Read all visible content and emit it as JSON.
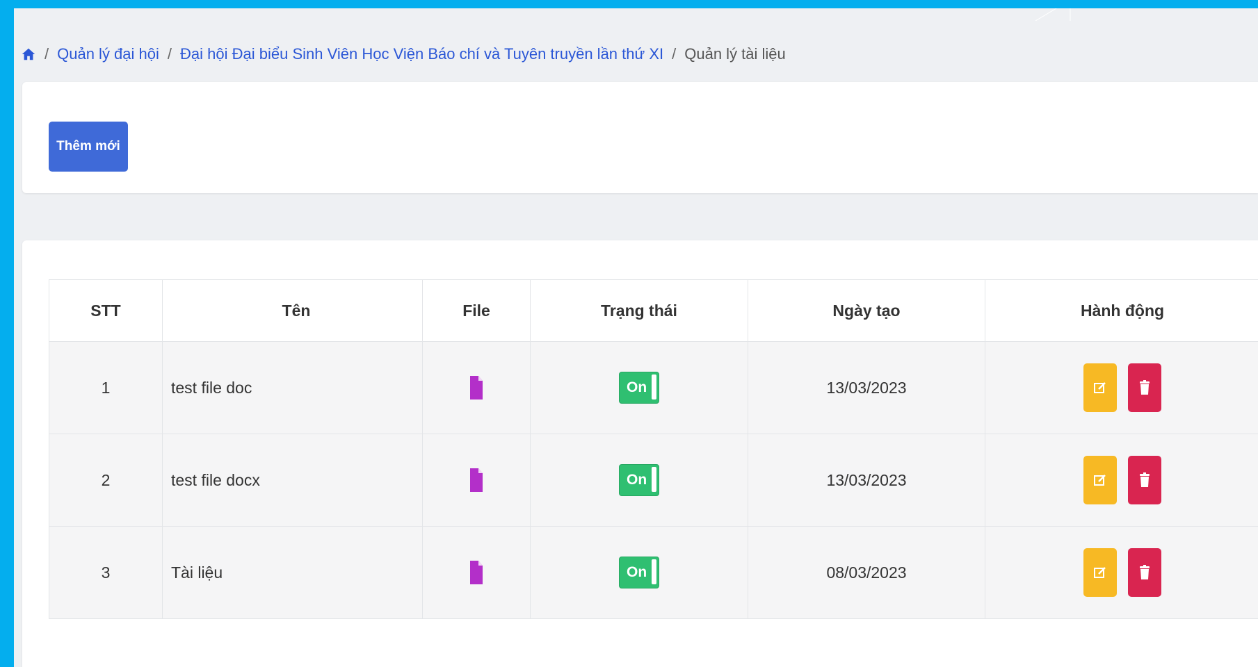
{
  "breadcrumb": {
    "home_icon": "home-icon",
    "items": [
      "Quản lý đại hội",
      "Đại hội Đại biểu Sinh Viên Học Viện Báo chí và Tuyên truyền lần thứ XI",
      "Quản lý tài liệu"
    ]
  },
  "toolbar": {
    "add_label": "Thêm mới"
  },
  "table": {
    "headers": [
      "STT",
      "Tên",
      "File",
      "Trạng thái",
      "Ngày tạo",
      "Hành động"
    ],
    "rows": [
      {
        "stt": "1",
        "name": "test file doc",
        "file_icon": "file-icon",
        "status": "On",
        "date": "13/03/2023"
      },
      {
        "stt": "2",
        "name": "test file docx",
        "file_icon": "file-icon",
        "status": "On",
        "date": "13/03/2023"
      },
      {
        "stt": "3",
        "name": "Tài liệu",
        "file_icon": "file-icon",
        "status": "On",
        "date": "08/03/2023"
      }
    ]
  },
  "colors": {
    "primary": "#3f6ad8",
    "link": "#2b57d6",
    "file_icon": "#b32fc9",
    "toggle_on": "#2fbf71",
    "edit": "#f7b924",
    "delete": "#d92550",
    "frame_border": "#04aeee"
  }
}
